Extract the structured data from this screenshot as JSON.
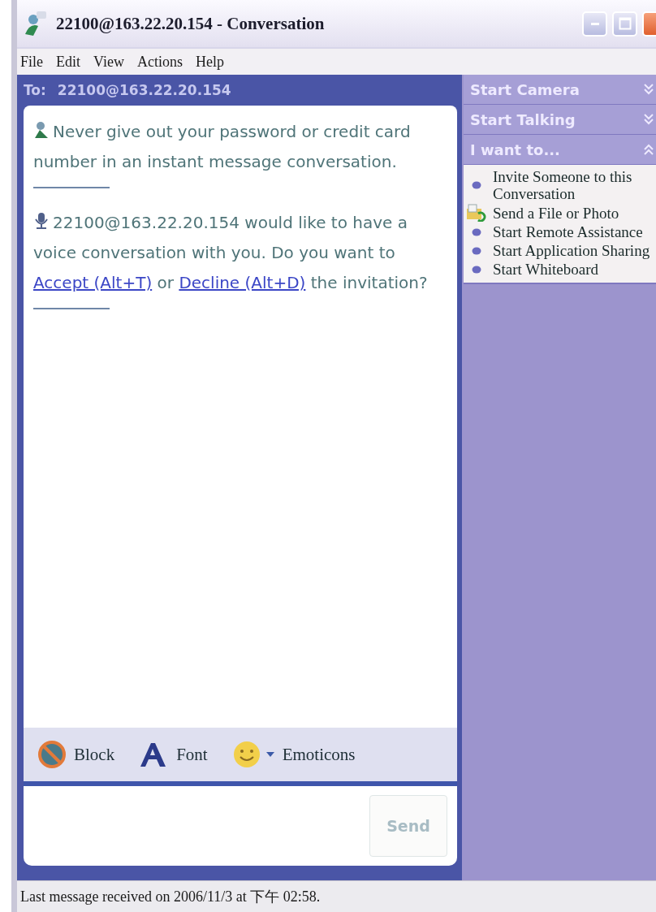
{
  "window": {
    "title": "22100@163.22.20.154 - Conversation"
  },
  "menu": [
    "File",
    "Edit",
    "View",
    "Actions",
    "Help"
  ],
  "to_bar": {
    "label": "To:",
    "address": "22100@163.22.20.154"
  },
  "messages": [
    {
      "kind": "warning",
      "parts": [
        {
          "kind": "text",
          "text": "Never give out your password or credit card number in an instant message conversation."
        }
      ]
    },
    {
      "kind": "voice",
      "parts": [
        {
          "kind": "text",
          "text": "22100@163.22.20.154 would like to have a voice conversation with you. Do you want to "
        },
        {
          "kind": "link",
          "text": "Accept (Alt+T)"
        },
        {
          "kind": "text",
          "text": " or "
        },
        {
          "kind": "link",
          "text": "Decline (Alt+D)"
        },
        {
          "kind": "text",
          "text": " the invitation?"
        }
      ]
    }
  ],
  "toolbar": [
    {
      "kind": "block",
      "label": "Block"
    },
    {
      "kind": "font",
      "label": "Font"
    },
    {
      "kind": "emoticons",
      "label": "Emoticons"
    }
  ],
  "send_button": {
    "label": "Send",
    "disabled": true
  },
  "sidebar": [
    {
      "title": "Start Camera",
      "expanded": false
    },
    {
      "title": "Start Talking",
      "expanded": false
    },
    {
      "title": "I want to...",
      "expanded": true,
      "items": [
        {
          "kind": "bullet",
          "label": "Invite Someone to this Conversation"
        },
        {
          "kind": "file",
          "label": "Send a File or Photo"
        },
        {
          "kind": "bullet",
          "label": "Start Remote Assistance"
        },
        {
          "kind": "bullet",
          "label": "Start Application Sharing"
        },
        {
          "kind": "bullet",
          "label": "Start Whiteboard"
        }
      ]
    }
  ],
  "status_bar": "Last message received on 2006/11/3 at 下午 02:58."
}
